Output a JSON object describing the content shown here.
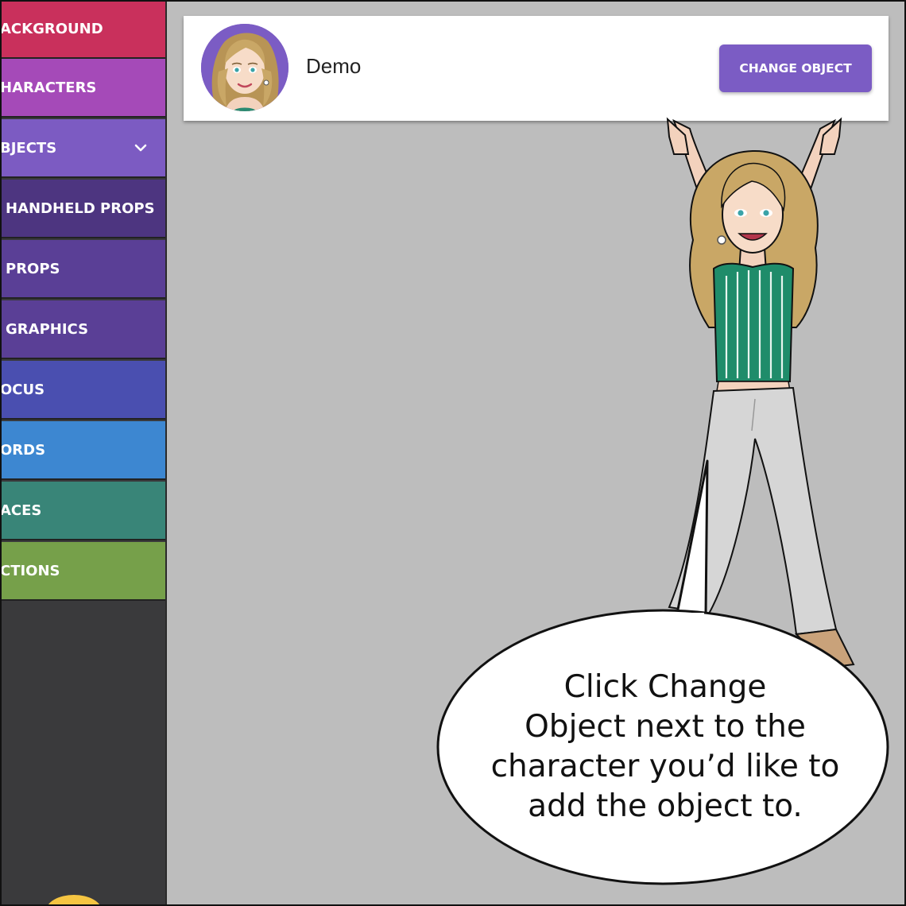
{
  "sidebar": {
    "items": [
      {
        "label": "ACKGROUND",
        "color": "#c9305c"
      },
      {
        "label": "HARACTERS",
        "color": "#a54ab8"
      },
      {
        "label": "BJECTS",
        "color": "#7c5bc2",
        "icon": "chevron-down-icon"
      },
      {
        "label": "HANDHELD PROPS",
        "color": "#4d3580"
      },
      {
        "label": "PROPS",
        "color": "#5a3f96"
      },
      {
        "label": "GRAPHICS",
        "color": "#5a3f96"
      },
      {
        "label": "OCUS",
        "color": "#4a4fb0"
      },
      {
        "label": "ORDS",
        "color": "#3d87d1"
      },
      {
        "label": "ACES",
        "color": "#398578"
      },
      {
        "label": "CTIONS",
        "color": "#76a04a"
      }
    ]
  },
  "card": {
    "name": "Demo",
    "button_label": "CHANGE OBJECT",
    "accent": "#7b5cc4"
  },
  "bubble": {
    "lines": [
      "Click Change",
      "Object next to the",
      "character you’d like to",
      "add the object to."
    ]
  }
}
